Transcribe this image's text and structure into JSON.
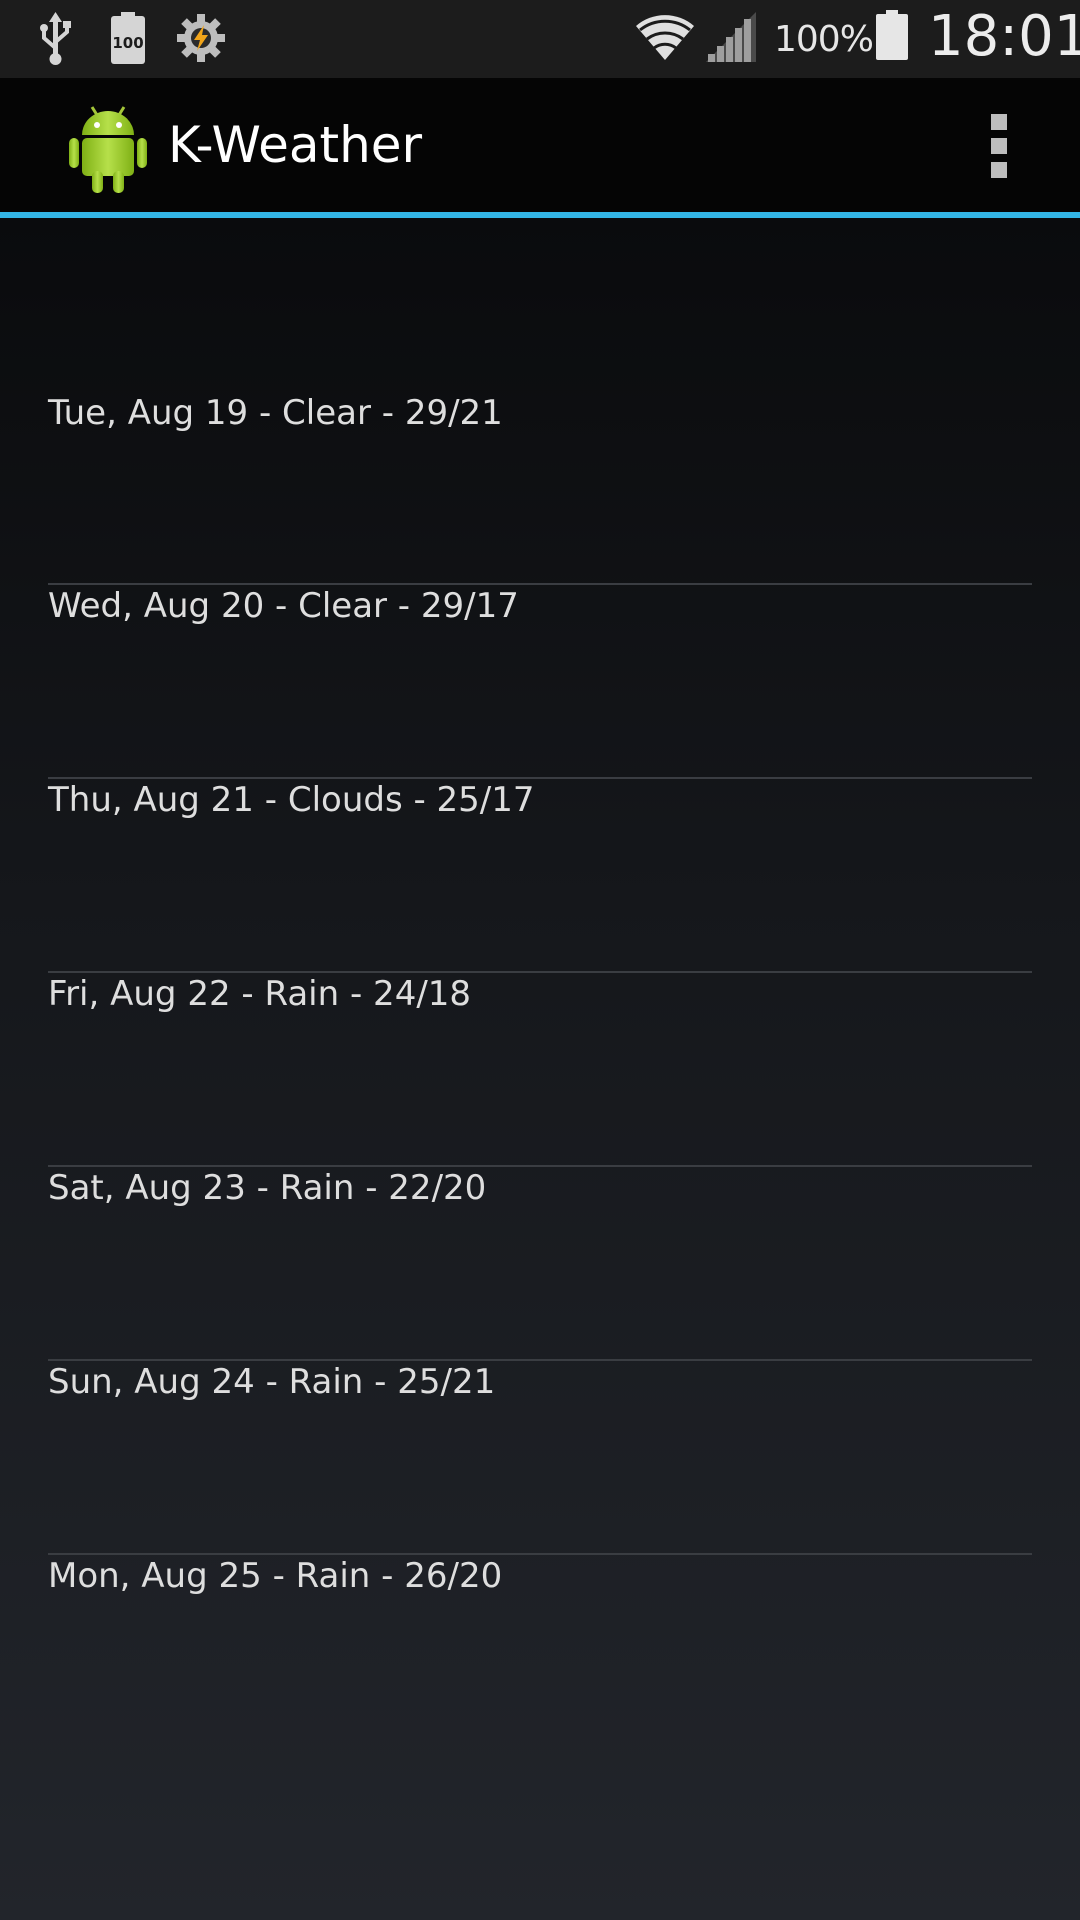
{
  "status_bar": {
    "icons": [
      "usb-icon",
      "battery-100-notification-icon",
      "tasker-icon",
      "wifi-icon",
      "cell-signal-icon",
      "battery-icon"
    ],
    "battery_percent": "100%",
    "time": "18:01"
  },
  "action_bar": {
    "app_icon": "android-robot-icon",
    "title": "K-Weather",
    "menu_icon": "overflow-menu-icon"
  },
  "colors": {
    "accent": "#33b5e5",
    "android_green": "#a4c639"
  },
  "forecast": {
    "items": [
      {
        "label": "Tue, Aug 19 - Clear - 29/21"
      },
      {
        "label": "Wed, Aug 20 - Clear - 29/17"
      },
      {
        "label": "Thu, Aug 21 - Clouds - 25/17"
      },
      {
        "label": "Fri, Aug 22 - Rain - 24/18"
      },
      {
        "label": "Sat, Aug 23 - Rain - 22/20"
      },
      {
        "label": "Sun, Aug 24 - Rain - 25/21"
      },
      {
        "label": "Mon, Aug 25 - Rain - 26/20"
      }
    ]
  }
}
